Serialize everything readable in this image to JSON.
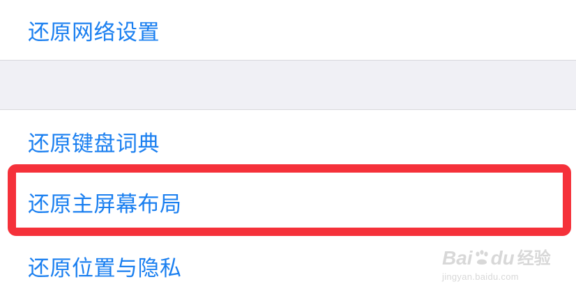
{
  "settings": {
    "items": [
      {
        "label": "还原网络设置"
      },
      {
        "label": "还原键盘词典"
      },
      {
        "label": "还原主屏幕布局"
      },
      {
        "label": "还原位置与隐私"
      }
    ]
  },
  "annotation": {
    "highlight_color": "#f5313a",
    "highlighted_item": "还原主屏幕布局"
  },
  "colors": {
    "link_blue": "#1a7ff0",
    "section_gap": "#f0f0f5"
  },
  "watermark": {
    "logo_text_left": "Bai",
    "logo_text_right": "du",
    "logo_suffix": "经验",
    "url": "jingyan.baidu.com"
  }
}
